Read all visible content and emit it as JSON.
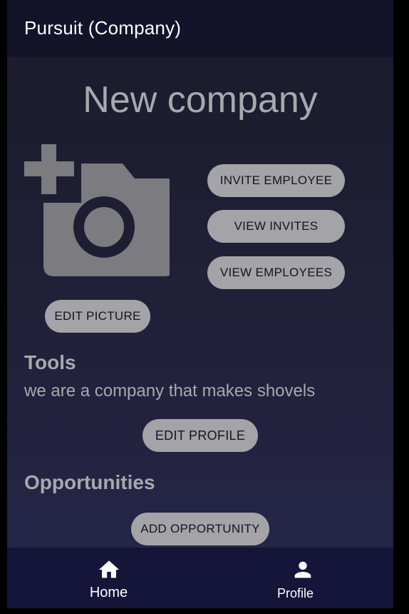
{
  "app_bar": {
    "title": "Pursuit (Company)"
  },
  "company": {
    "name": "New company",
    "picture_icon": "add-photo-icon"
  },
  "actions": {
    "invite_employee": "INVITE EMPLOYEE",
    "view_invites": "VIEW INVITES",
    "view_employees": "VIEW EMPLOYEES",
    "edit_picture": "EDIT PICTURE"
  },
  "profile_section": {
    "heading": "Tools",
    "description": "we are a company that makes shovels",
    "edit_profile": "EDIT PROFILE"
  },
  "opportunities": {
    "heading": "Opportunities",
    "add_opportunity": "ADD OPPORTUNITY"
  },
  "bottom_nav": {
    "items": [
      {
        "label": "Home",
        "icon": "home-icon"
      },
      {
        "label": "Profile",
        "icon": "person-icon"
      }
    ]
  },
  "colors": {
    "app_bar": "#13132a",
    "button": "#a3a3a8",
    "text_muted": "#a8a8ad",
    "bottom_nav": "#15153a"
  }
}
